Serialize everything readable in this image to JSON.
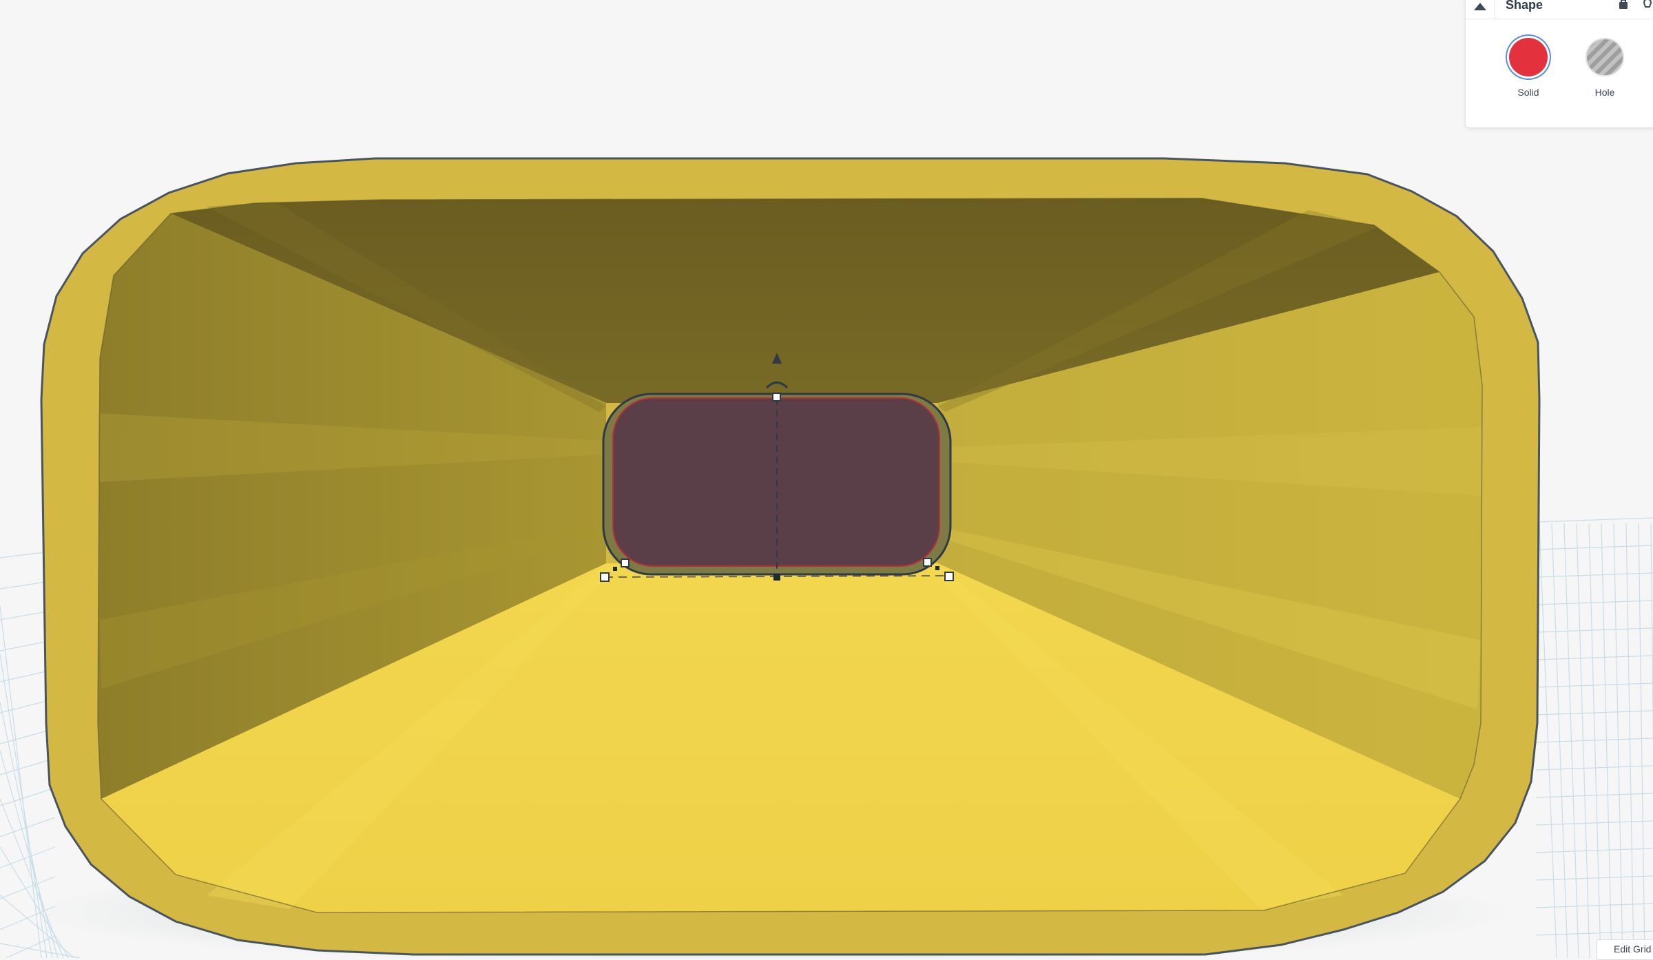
{
  "inspector": {
    "title": "Shape",
    "solid_label": "Solid",
    "hole_label": "Hole",
    "solid_color": "#e3323e",
    "selected": "Solid",
    "icons": [
      "collapse-icon",
      "lock-icon",
      "lightbulb-icon"
    ]
  },
  "workplane": {
    "edit_grid_label": "Edit Grid",
    "grid_color": "#c3dbe8"
  },
  "scene": {
    "box_color": "#d3b843",
    "inner_light": "#f2d64c",
    "inner_dark": "#6d6022",
    "selected_shape_color": "#5b3f48"
  }
}
